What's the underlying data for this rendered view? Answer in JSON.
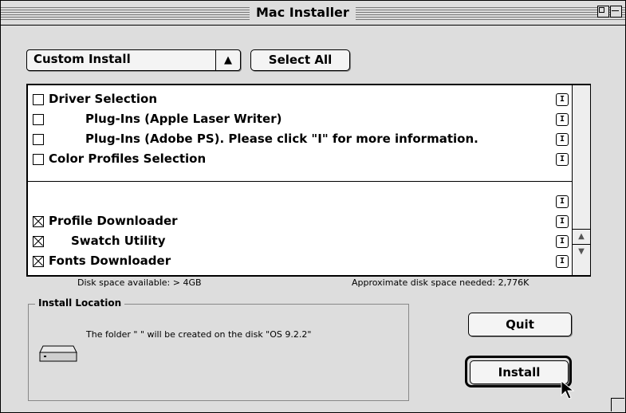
{
  "window": {
    "title": "Mac Installer"
  },
  "toolbar": {
    "install_type": "Custom Install",
    "select_all_label": "Select All"
  },
  "components": {
    "items": [
      {
        "label": "Driver Selection",
        "checked": false,
        "info": "I"
      },
      {
        "label": "Plug-Ins (Apple Laser Writer)",
        "checked": false,
        "info": "I"
      },
      {
        "label": "Plug-Ins (Adobe PS). Please click \"I\" for more information.",
        "checked": false,
        "info": "I"
      },
      {
        "label": "Color Profiles Selection",
        "checked": false,
        "info": "I"
      },
      {
        "label": "",
        "checked": false,
        "info": "I"
      },
      {
        "label": "Profile Downloader",
        "checked": true,
        "info": "I"
      },
      {
        "label": "Swatch Utility",
        "checked": true,
        "info": "I"
      },
      {
        "label": "Fonts Downloader",
        "checked": true,
        "info": "I"
      }
    ]
  },
  "disk": {
    "available": "Disk space available: > 4GB",
    "needed": "Approximate disk space needed: 2,776K"
  },
  "install_location": {
    "legend": "Install Location",
    "message": "The folder \"          \" will be created on the disk \"OS 9.2.2\""
  },
  "buttons": {
    "quit": "Quit",
    "install": "Install"
  }
}
